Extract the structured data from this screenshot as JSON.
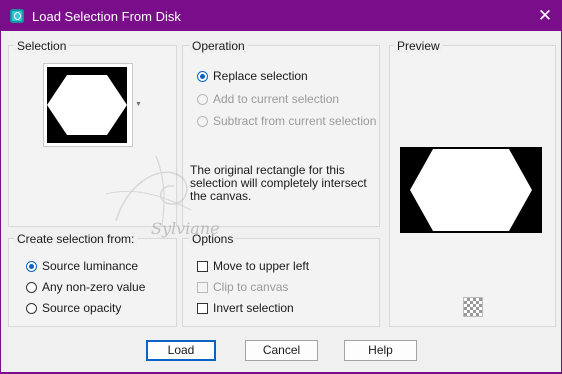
{
  "window": {
    "title": "Load Selection From Disk",
    "close_symbol": "✕"
  },
  "selection_group": {
    "label": "Selection"
  },
  "operation_group": {
    "label": "Operation",
    "options": [
      {
        "label": "Replace selection",
        "checked": true,
        "enabled": true
      },
      {
        "label": "Add to current selection",
        "checked": false,
        "enabled": false
      },
      {
        "label": "Subtract from current selection",
        "checked": false,
        "enabled": false
      }
    ],
    "info": "The original rectangle for this selection will completely intersect the canvas."
  },
  "preview_group": {
    "label": "Preview"
  },
  "create_from_group": {
    "label": "Create selection from:",
    "options": [
      {
        "label": "Source luminance",
        "checked": true
      },
      {
        "label": "Any non-zero value",
        "checked": false
      },
      {
        "label": "Source opacity",
        "checked": false
      }
    ]
  },
  "options_group": {
    "label": "Options",
    "items": [
      {
        "label": "Move to upper left",
        "checked": false,
        "enabled": true
      },
      {
        "label": "Clip to canvas",
        "checked": false,
        "enabled": false
      },
      {
        "label": "Invert selection",
        "checked": false,
        "enabled": true
      }
    ]
  },
  "buttons": {
    "load": "Load",
    "cancel": "Cancel",
    "help": "Help"
  },
  "watermark": {
    "text": "Sylviane"
  },
  "colors": {
    "title_bar": "#7a0e8a",
    "accent": "#0b63c8",
    "dialog_bg": "#f0f0f0"
  },
  "icons": {
    "app": "load-selection-icon",
    "close": "close-icon",
    "preview_toggle": "checkerboard-icon"
  }
}
